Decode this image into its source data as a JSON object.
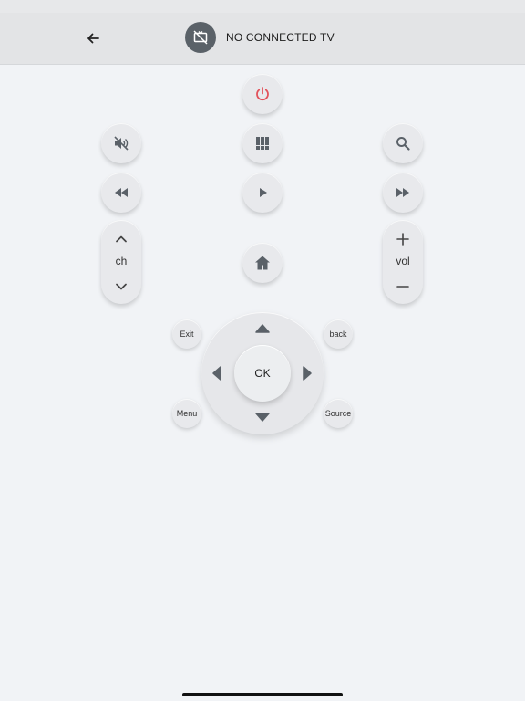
{
  "header": {
    "title": "NO CONNECTED TV",
    "back_icon": "arrow-left-icon",
    "tv_icon": "tv-off-icon"
  },
  "remote": {
    "buttons": {
      "power_icon": "power-icon",
      "mute_icon": "volume-off-icon",
      "apps_icon": "apps-grid-icon",
      "search_icon": "search-icon",
      "rewind_icon": "rewind-icon",
      "play_icon": "play-icon",
      "fast_forward_icon": "fast-forward-icon",
      "home_icon": "home-icon"
    },
    "channel": {
      "label": "ch"
    },
    "volume": {
      "label": "vol"
    },
    "dpad": {
      "ok_label": "OK"
    },
    "shortcuts": {
      "exit": "Exit",
      "back": "back",
      "menu": "Menu",
      "source": "Source"
    }
  },
  "colors": {
    "background": "#f1f3f6",
    "header": "#e3e4e6",
    "button": "#e8e9ec",
    "icon": "#5a6168",
    "power": "#e2525b"
  }
}
